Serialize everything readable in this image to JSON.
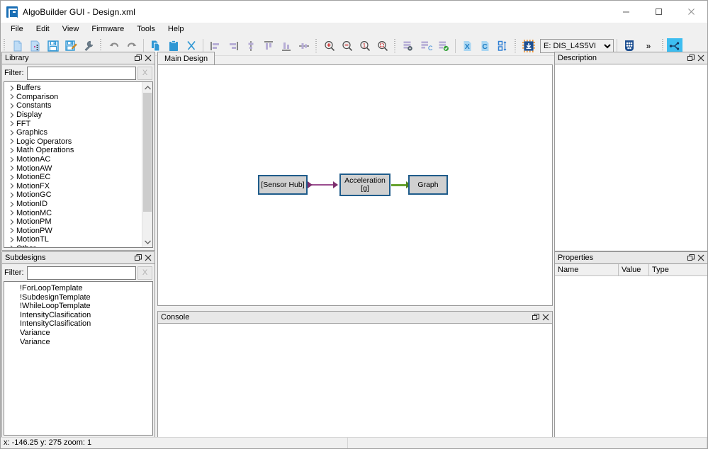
{
  "window": {
    "title": "AlgoBuilder GUI - Design.xml",
    "app_icon": "algobuilder-icon",
    "minimize_label": "Minimize",
    "maximize_label": "Maximize",
    "close_label": "Close"
  },
  "menubar": {
    "items": [
      {
        "label": "File"
      },
      {
        "label": "Edit"
      },
      {
        "label": "View"
      },
      {
        "label": "Firmware"
      },
      {
        "label": "Tools"
      },
      {
        "label": "Help"
      }
    ]
  },
  "toolbar": {
    "groups": [
      {
        "buttons": [
          {
            "icon": "new-file-icon",
            "name": "new-design-button"
          },
          {
            "icon": "open-file-icon",
            "name": "open-design-button"
          },
          {
            "icon": "save-icon",
            "name": "save-button"
          },
          {
            "icon": "save-as-icon",
            "name": "save-as-button"
          },
          {
            "icon": "wrench-icon",
            "name": "preferences-button"
          }
        ]
      },
      {
        "buttons": [
          {
            "icon": "undo-icon",
            "name": "undo-button"
          },
          {
            "icon": "redo-icon",
            "name": "redo-button"
          }
        ]
      },
      {
        "buttons": [
          {
            "icon": "copy-icon",
            "name": "copy-button"
          },
          {
            "icon": "paste-icon",
            "name": "paste-button"
          },
          {
            "icon": "cut-icon",
            "name": "cut-button"
          }
        ]
      },
      {
        "buttons": [
          {
            "icon": "align-left-icon",
            "name": "align-left-button"
          },
          {
            "icon": "align-right-icon",
            "name": "align-right-button"
          },
          {
            "icon": "align-center-vertical-icon",
            "name": "align-center-vertical-button"
          },
          {
            "icon": "align-top-icon",
            "name": "align-top-button"
          },
          {
            "icon": "align-bottom-icon",
            "name": "align-bottom-button"
          },
          {
            "icon": "align-middle-icon",
            "name": "align-middle-button"
          }
        ]
      },
      {
        "buttons": [
          {
            "icon": "zoom-in-icon",
            "name": "zoom-in-button"
          },
          {
            "icon": "zoom-out-icon",
            "name": "zoom-out-button"
          },
          {
            "icon": "zoom-actual-icon",
            "name": "zoom-100-button"
          },
          {
            "icon": "zoom-fit-icon",
            "name": "zoom-fit-button"
          }
        ]
      },
      {
        "buttons": [
          {
            "icon": "build-settings-icon",
            "name": "build-settings-button"
          },
          {
            "icon": "generate-code-icon",
            "name": "generate-code-button"
          },
          {
            "icon": "validate-icon",
            "name": "validate-button"
          },
          {
            "icon": "export-x-icon",
            "name": "export-x-button"
          },
          {
            "icon": "export-c-icon",
            "name": "export-c-button"
          },
          {
            "icon": "reorder-icon",
            "name": "reorder-button"
          }
        ]
      },
      {
        "buttons": [
          {
            "icon": "flash-chip-icon",
            "name": "flash-firmware-button"
          }
        ]
      }
    ],
    "board_select": {
      "value": "E: DIS_L4S5VI",
      "name": "board-selector"
    },
    "keypad_button": {
      "icon": "keypad-icon",
      "name": "unicleo-button"
    },
    "overflow_label": "»",
    "logo_button": {
      "icon": "algobuilder-logo-icon",
      "name": "algobuilder-logo-button"
    }
  },
  "library": {
    "title": "Library",
    "filter_label": "Filter:",
    "filter_value": "",
    "filter_placeholder": "",
    "clear_label": "X",
    "items": [
      {
        "label": "Buffers"
      },
      {
        "label": "Comparison"
      },
      {
        "label": "Constants"
      },
      {
        "label": "Display"
      },
      {
        "label": "FFT"
      },
      {
        "label": "Graphics"
      },
      {
        "label": "Logic Operators"
      },
      {
        "label": "Math Operations"
      },
      {
        "label": "MotionAC"
      },
      {
        "label": "MotionAW"
      },
      {
        "label": "MotionEC"
      },
      {
        "label": "MotionFX"
      },
      {
        "label": "MotionGC"
      },
      {
        "label": "MotionID"
      },
      {
        "label": "MotionMC"
      },
      {
        "label": "MotionPM"
      },
      {
        "label": "MotionPW"
      },
      {
        "label": "MotionTL"
      },
      {
        "label": "Other"
      }
    ]
  },
  "subdesigns": {
    "title": "Subdesigns",
    "filter_label": "Filter:",
    "filter_value": "",
    "clear_label": "X",
    "items": [
      {
        "label": "!ForLoopTemplate"
      },
      {
        "label": "!SubdesignTemplate"
      },
      {
        "label": "!WhileLoopTemplate"
      },
      {
        "label": "IntensityClasification"
      },
      {
        "label": "IntensityClasification"
      },
      {
        "label": "Variance"
      },
      {
        "label": "Variance"
      }
    ]
  },
  "main": {
    "tabs": [
      {
        "label": "Main Design"
      }
    ],
    "diagram": {
      "nodes": [
        {
          "name": "sensor-hub-node",
          "label": "[Sensor Hub]"
        },
        {
          "name": "acceleration-node",
          "label": "Acceleration\n[g]"
        },
        {
          "name": "graph-node",
          "label": "Graph"
        }
      ],
      "node_labels": {
        "sensor_hub": "[Sensor Hub]",
        "acceleration_line1": "Acceleration",
        "acceleration_line2": "[g]",
        "graph": "Graph"
      },
      "wire_colors": {
        "sensor_to_accel": "#9b4d8f",
        "accel_to_graph": "#66a22e"
      },
      "node_fill": "#d0d0d0",
      "node_border": "#1f5c8b"
    }
  },
  "console": {
    "title": "Console",
    "content": ""
  },
  "description": {
    "title": "Description",
    "content": ""
  },
  "properties": {
    "title": "Properties",
    "columns": [
      {
        "label": "Name"
      },
      {
        "label": "Value"
      },
      {
        "label": "Type"
      }
    ],
    "rows": []
  },
  "statusbar": {
    "coords": "x: -146.25  y: 275  zoom: 1"
  }
}
